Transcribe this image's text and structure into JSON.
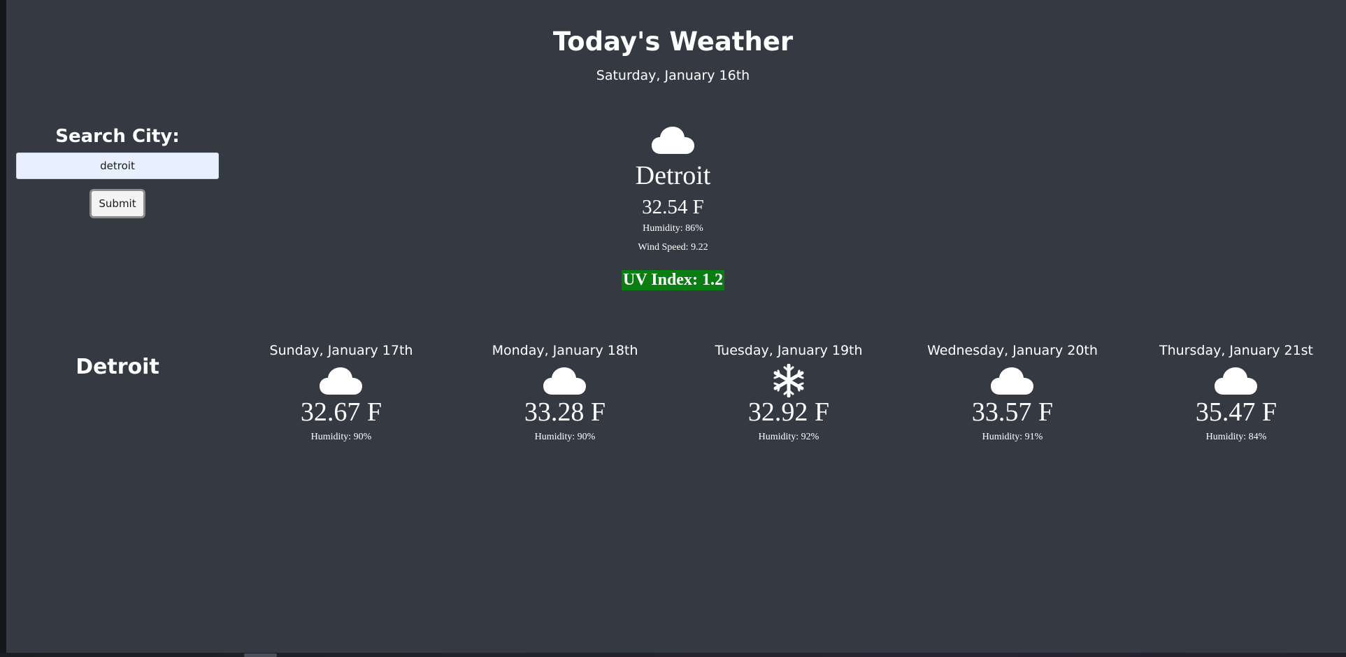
{
  "header": {
    "title": "Today's Weather",
    "date": "Saturday, January 16th"
  },
  "search": {
    "label": "Search City:",
    "input_value": "detroit",
    "submit_label": "Submit"
  },
  "saved_cities": [
    "Detroit"
  ],
  "current": {
    "icon": "cloud-icon",
    "city": "Detroit",
    "temp": "32.54 F",
    "humidity": "Humidity: 86%",
    "wind": "Wind Speed: 9.22",
    "uv": "UV Index: 1.2",
    "uv_color": "#0a7d12"
  },
  "forecast": [
    {
      "date": "Sunday, January 17th",
      "icon": "cloud-icon",
      "temp": "32.67 F",
      "humidity": "Humidity: 90%"
    },
    {
      "date": "Monday, January 18th",
      "icon": "cloud-icon",
      "temp": "33.28 F",
      "humidity": "Humidity: 90%"
    },
    {
      "date": "Tuesday, January 19th",
      "icon": "snowflake-icon",
      "temp": "32.92 F",
      "humidity": "Humidity: 92%"
    },
    {
      "date": "Wednesday, January 20th",
      "icon": "cloud-icon",
      "temp": "33.57 F",
      "humidity": "Humidity: 91%"
    },
    {
      "date": "Thursday, January 21st",
      "icon": "cloud-icon",
      "temp": "35.47 F",
      "humidity": "Humidity: 84%"
    }
  ],
  "colors": {
    "background": "#353a42",
    "text": "#ffffff",
    "input_background": "#e8f0fe"
  }
}
